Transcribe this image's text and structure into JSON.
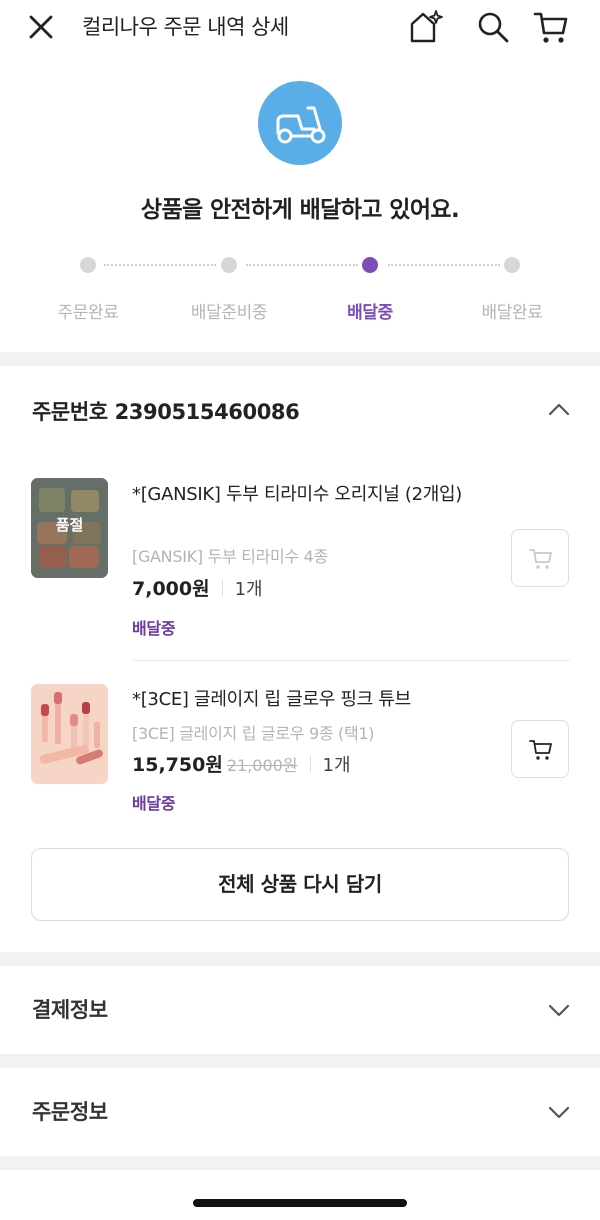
{
  "header": {
    "title": "컬리나우 주문 내역 상세",
    "icons": [
      "close-icon",
      "share-icon",
      "search-icon",
      "cart-icon"
    ]
  },
  "status": {
    "icon": "scooter-icon",
    "message": "상품을 안전하게 배달하고 있어요.",
    "steps": [
      "주문완료",
      "배달준비중",
      "배달중",
      "배달완료"
    ],
    "current_step_index": 2
  },
  "order": {
    "number_label": "주문번호 2390515460086",
    "items": [
      {
        "name": "*[GANSIK] 두부 티라미수 오리지널 (2개입)",
        "option": "[GANSIK] 두부 티라미수 4종",
        "price": "7,000원",
        "original_price": "",
        "quantity": "1개",
        "status": "배달중",
        "thumb_badge": "품절"
      },
      {
        "name": "*[3CE] 글레이지 립 글로우 핑크 튜브",
        "option": "[3CE] 글레이지 립 글로우 9종 (택1)",
        "price": "15,750원",
        "original_price": "21,000원",
        "quantity": "1개",
        "status": "배달중",
        "thumb_badge": ""
      }
    ],
    "readd_label": "전체 상품 다시 담기"
  },
  "sections": {
    "payment_label": "결제정보",
    "orderinfo_label": "주문정보"
  },
  "colors": {
    "accent": "#7e4cb9",
    "status_blue": "#5aaee8"
  }
}
